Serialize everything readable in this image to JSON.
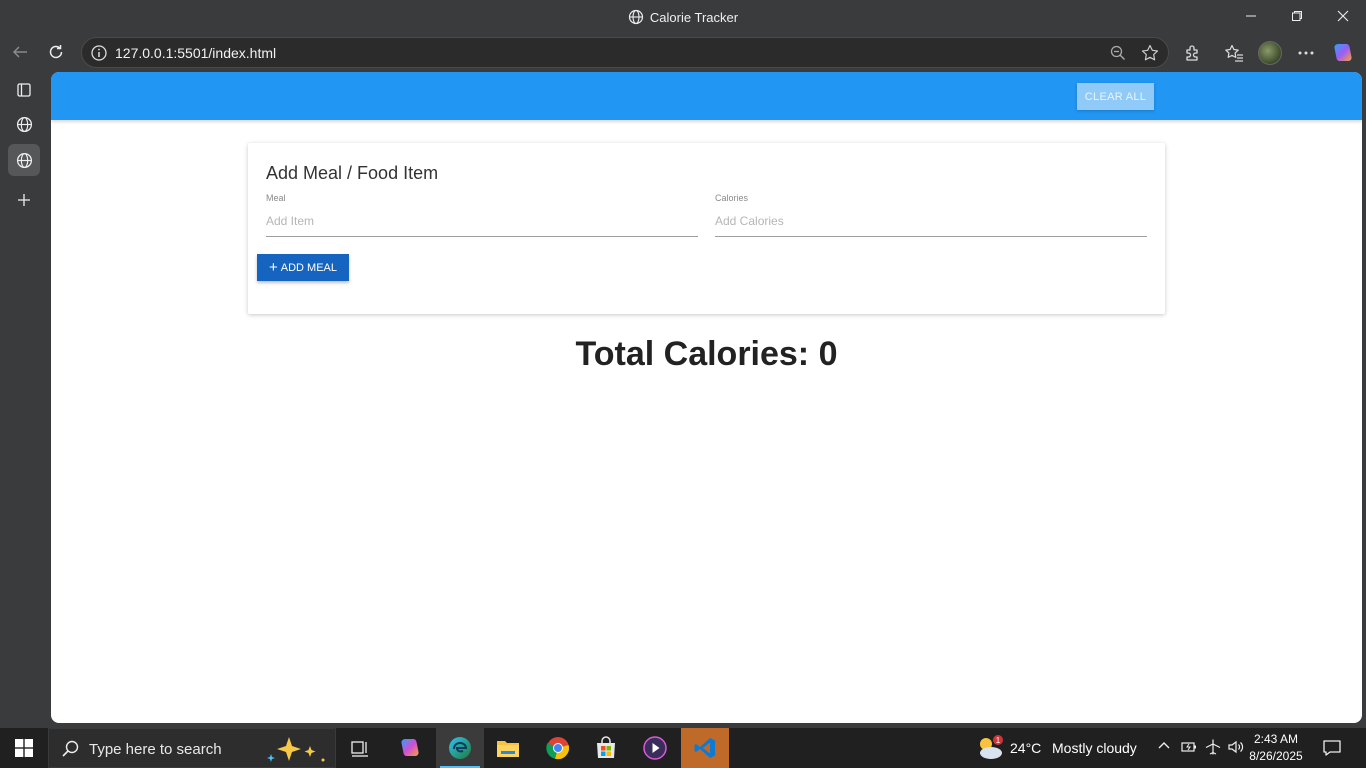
{
  "browser": {
    "window_title": "Calorie Tracker",
    "url": "127.0.0.1:5501/index.html"
  },
  "app": {
    "clear_all_label": "CLEAR ALL",
    "card_title": "Add Meal / Food Item",
    "meal_label": "Meal",
    "meal_placeholder": "Add Item",
    "calories_label": "Calories",
    "calories_placeholder": "Add Calories",
    "add_meal_label": "ADD MEAL",
    "total_text": "Total Calories: 0",
    "navbar_color": "#2196f3",
    "button_color": "#1565c0"
  },
  "taskbar": {
    "search_placeholder": "Type here to search",
    "weather_temp": "24°C",
    "weather_condition": "Mostly cloudy",
    "weather_badge": "1",
    "time": "2:43 AM",
    "date": "8/26/2025",
    "apps": [
      "task-view-icon",
      "copilot-icon",
      "edge-icon",
      "file-explorer-icon",
      "chrome-icon",
      "store-icon",
      "media-player-icon",
      "vscode-icon"
    ]
  }
}
